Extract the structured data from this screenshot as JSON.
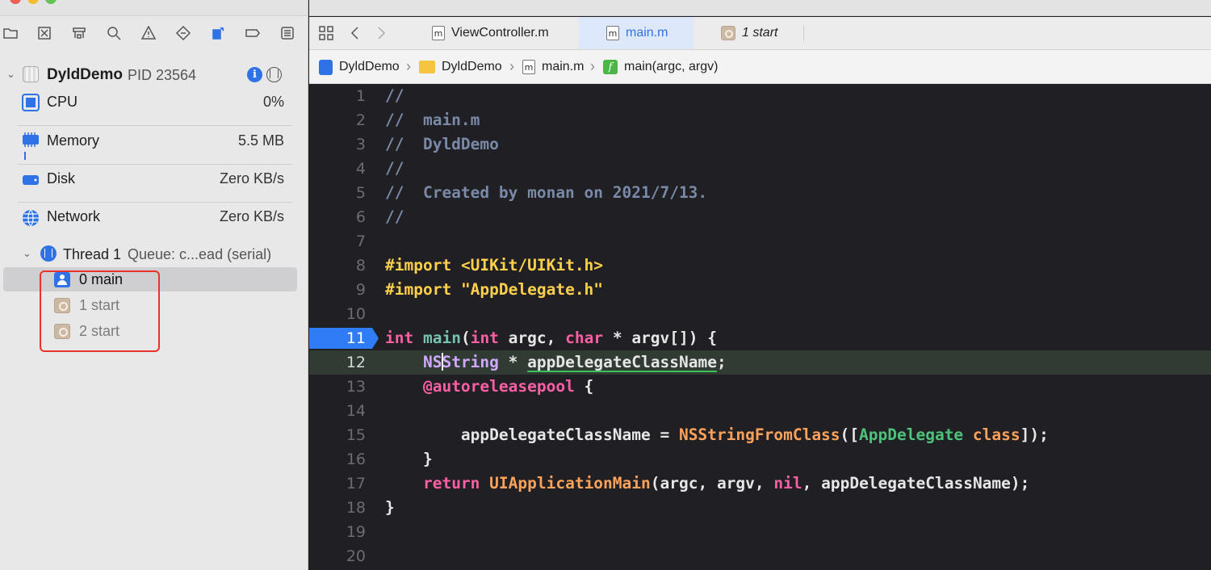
{
  "colors": {
    "accent": "#2e72e6",
    "breakpoint": "#2f7cf6",
    "highlight_box": "#e8322b",
    "editor_bg": "#1f1f24",
    "comment": "#7a8aa6",
    "keyword": "#fc5fa3",
    "preprocessor": "#fdd04c"
  },
  "navigator_toolbar": {
    "icons": [
      "folder-icon",
      "source-control-icon",
      "symbol-navigator-icon",
      "search-icon",
      "issue-warning-icon",
      "test-diamond-icon",
      "debug-navigator-icon",
      "breakpoint-navigator-icon",
      "report-icon"
    ],
    "active_icon": "debug-navigator-icon"
  },
  "process": {
    "name": "DyldDemo",
    "pid": "PID 23564"
  },
  "gauges": [
    {
      "label": "CPU",
      "value": "0%",
      "icon": "cpu-icon"
    },
    {
      "label": "Memory",
      "value": "5.5 MB",
      "icon": "memory-icon"
    },
    {
      "label": "Disk",
      "value": "Zero KB/s",
      "icon": "disk-icon"
    },
    {
      "label": "Network",
      "value": "Zero KB/s",
      "icon": "network-globe-icon"
    }
  ],
  "thread": {
    "name": "Thread 1",
    "queue": "Queue: c...ead (serial)"
  },
  "frames": [
    {
      "label": "0 main",
      "selected": true,
      "kind": "user"
    },
    {
      "label": "1 start",
      "selected": false,
      "kind": "system"
    },
    {
      "label": "2 start",
      "selected": false,
      "kind": "system"
    }
  ],
  "tabs": [
    {
      "label": "ViewController.m",
      "icon": "m",
      "active": false
    },
    {
      "label": "main.m",
      "icon": "m",
      "active": true
    },
    {
      "label": "1 start",
      "icon": "system-frame",
      "active": false
    }
  ],
  "jumpbar": {
    "project": "DyldDemo",
    "folder": "DyldDemo",
    "file": "main.m",
    "symbol": "main(argc, argv)",
    "file_icon_letter": "m",
    "func_icon_letter": "f"
  },
  "code": {
    "breakpoint_line": 11,
    "current_line": 12,
    "line_numbers": [
      "1",
      "2",
      "3",
      "4",
      "5",
      "6",
      "7",
      "8",
      "9",
      "10",
      "11",
      "12",
      "13",
      "14",
      "15",
      "16",
      "17",
      "18",
      "19",
      "20"
    ],
    "comment_1": "//",
    "comment_2": "//  main.m",
    "comment_3": "//  DyldDemo",
    "comment_4": "//",
    "comment_5": "//  Created by monan on 2021/7/13.",
    "comment_6": "//",
    "import_1_directive": "#import",
    "import_1_path": "<UIKit/UIKit.h>",
    "import_2_directive": "#import",
    "import_2_path": "\"AppDelegate.h\""
  }
}
